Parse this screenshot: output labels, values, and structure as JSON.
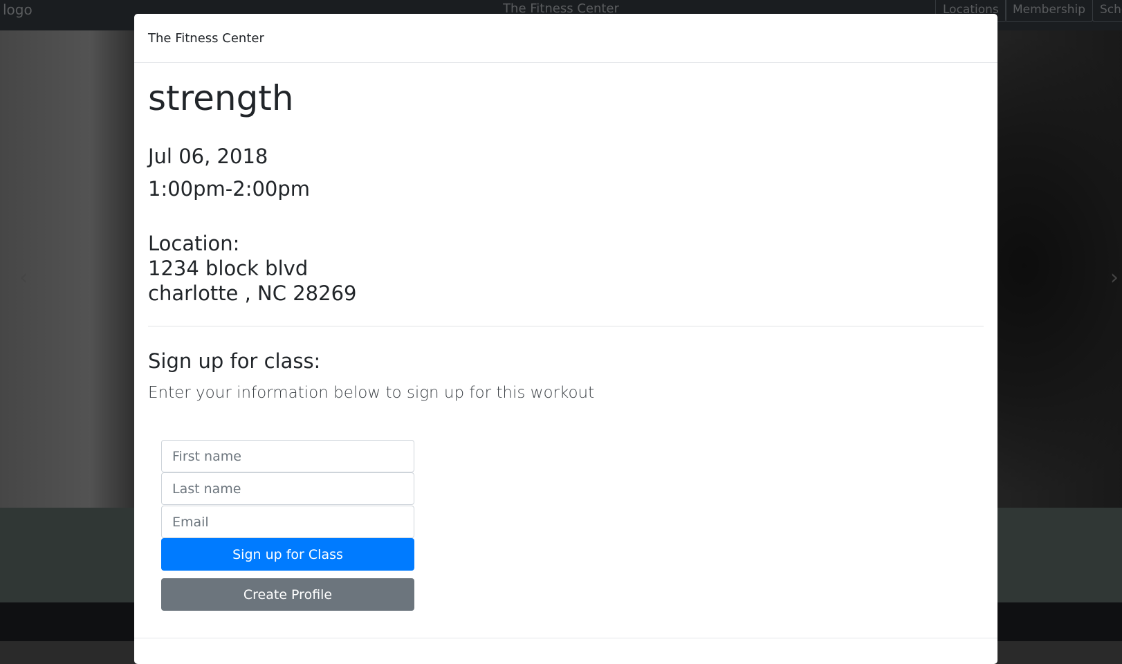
{
  "nav": {
    "logo": "logo",
    "brand": "The Fitness Center",
    "links": [
      "Locations",
      "Membership",
      "Sche"
    ]
  },
  "modal": {
    "title": "The Fitness Center",
    "class_name": "strength",
    "date": "Jul 06, 2018",
    "time": "1:00pm-2:00pm",
    "location_label": "Location:",
    "address_line1": "1234 block blvd",
    "address_line2": "charlotte , NC 28269",
    "signup_title": "Sign up for class:",
    "signup_subtitle": "Enter your information below to sign up for this workout",
    "form": {
      "first_name_placeholder": "First name",
      "last_name_placeholder": "Last name",
      "email_placeholder": "Email",
      "signup_button": "Sign up for Class",
      "create_profile_button": "Create Profile"
    }
  },
  "carousel": {
    "prev_icon": "chevron-left-icon",
    "next_icon": "chevron-right-icon"
  },
  "colors": {
    "primary": "#007bff",
    "secondary": "#6c757d",
    "navbar": "#343a40"
  }
}
